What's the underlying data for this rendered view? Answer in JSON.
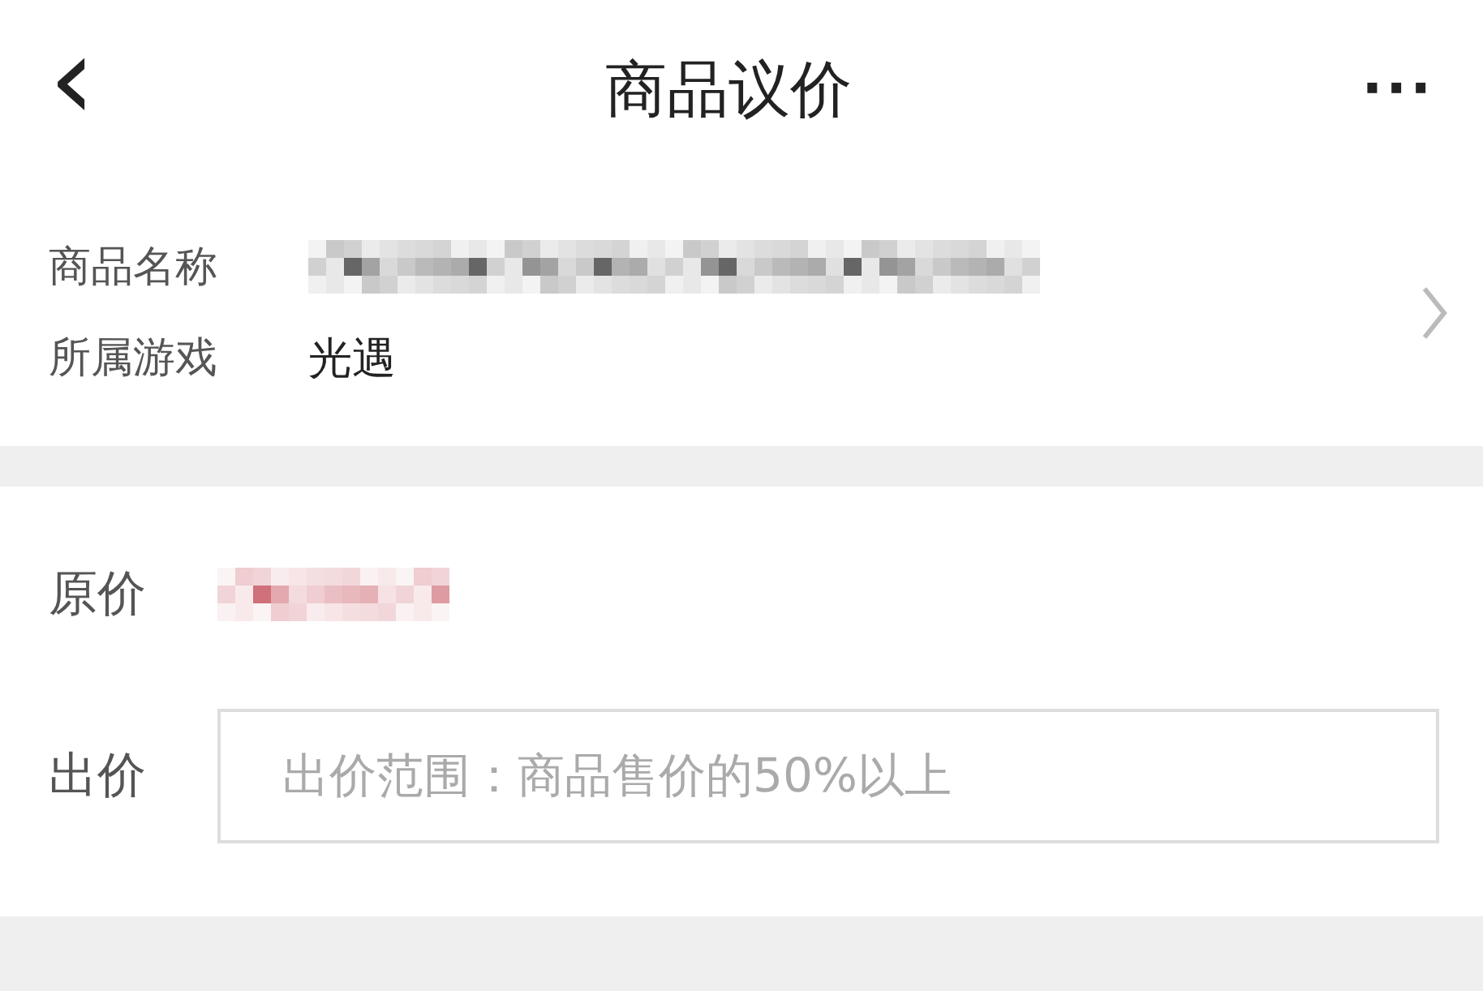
{
  "header": {
    "back": "‹",
    "title": "商品议价",
    "more": "···"
  },
  "product": {
    "rows": [
      {
        "label": "商品名称",
        "value": {
          "kind": "redacted",
          "color": "#666666"
        }
      },
      {
        "label": "所属游戏",
        "value": {
          "kind": "text",
          "text": "光遇"
        }
      }
    ]
  },
  "price": {
    "original": {
      "label": "原价",
      "value": {
        "kind": "redacted",
        "color": "#d0707a"
      }
    },
    "offer": {
      "label": "出价",
      "placeholder": "出价范围：商品售价的50%以上"
    }
  }
}
